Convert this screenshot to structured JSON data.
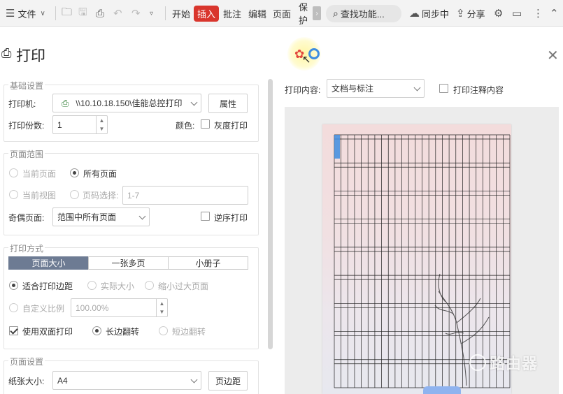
{
  "toolbar": {
    "file_label": "文件",
    "tabs": [
      "开始",
      "插入",
      "批注",
      "编辑",
      "页面",
      "保护"
    ],
    "active_tab": "插入",
    "search_label": "查找功能...",
    "sync_label": "同步中",
    "share_label": "分享"
  },
  "dialog": {
    "title": "打印",
    "basic": {
      "section": "基础设置",
      "printer_label": "打印机:",
      "printer_value": "\\\\10.10.18.150\\佳能总控打印",
      "properties_button": "属性",
      "copies_label": "打印份数:",
      "copies_value": "1",
      "color_label": "颜色:",
      "grayscale_label": "灰度打印"
    },
    "range": {
      "section": "页面范围",
      "current_page": "当前页面",
      "all_pages": "所有页面",
      "current_view": "当前视图",
      "page_select": "页码选择:",
      "page_select_value": "1-7",
      "odd_even_label": "奇偶页面:",
      "odd_even_value": "范围中所有页面",
      "reverse_label": "逆序打印"
    },
    "mode": {
      "section": "打印方式",
      "tabs": [
        "页面大小",
        "一张多页",
        "小册子"
      ],
      "active_tab": "页面大小",
      "fit_margins": "适合打印边距",
      "actual_size": "实际大小",
      "shrink_large": "缩小过大页面",
      "custom_scale": "自定义比例",
      "custom_scale_value": "100.00%",
      "duplex_label": "使用双面打印",
      "long_edge": "长边翻转",
      "short_edge": "短边翻转"
    },
    "page_setup": {
      "section": "页面设置",
      "paper_label": "纸张大小:",
      "paper_value": "A4",
      "margins_button": "页边距"
    },
    "preview": {
      "content_label": "打印内容:",
      "content_value": "文档与标注",
      "annotation_label": "打印注释内容"
    }
  },
  "watermark": "路由器",
  "colors": {
    "accent_red": "#d9362d",
    "segment_active": "#6d7b93",
    "preview_blue": "#3e8de0"
  }
}
